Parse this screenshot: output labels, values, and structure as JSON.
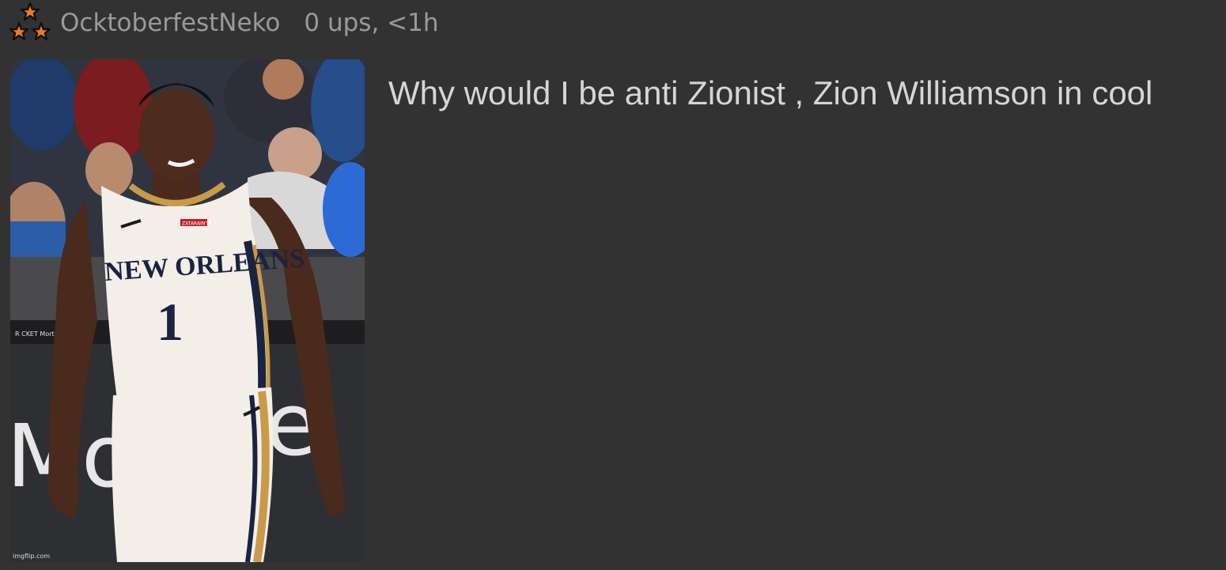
{
  "post": {
    "author": "OcktoberfestNeko",
    "meta": "0 ups, <1h",
    "badge_icon": "three-stars-icon",
    "caption": "Why would I be anti Zionist , Zion Williamson in cool",
    "image": {
      "jersey_text": "NEW ORLEANS",
      "jersey_number": "1",
      "sponsor_patch": "ZATARAIN'S",
      "banner_text": "Mor",
      "banner_text_right": "e",
      "board_text": "R CKET Mortgage",
      "watermark": "imgflip.com"
    }
  },
  "colors": {
    "background": "#323232",
    "meta_text": "#9a9a9a",
    "caption_text": "#d6d6d6",
    "star_orange": "#f07a1e"
  }
}
